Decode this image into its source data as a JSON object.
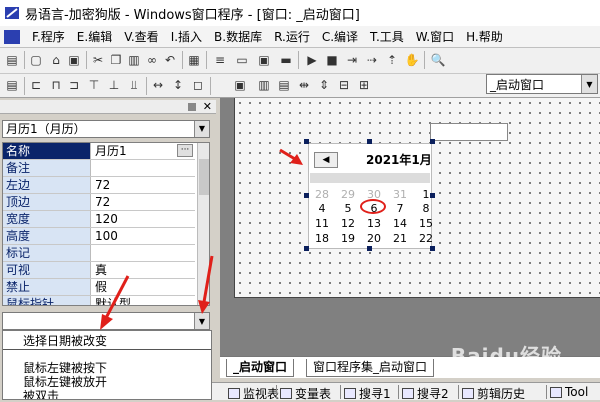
{
  "window": {
    "title": "易语言-加密狗版 - Windows窗口程序 - [窗口: _启动窗口]"
  },
  "menu": [
    "F.程序",
    "E.编辑",
    "V.查看",
    "I.插入",
    "B.数据库",
    "R.运行",
    "C.编译",
    "T.工具",
    "W.窗口",
    "H.帮助"
  ],
  "window_selector": {
    "value": "_启动窗口"
  },
  "object_selector": {
    "value": "月历1（月历）"
  },
  "properties": [
    {
      "name": "名称",
      "value": "月历1"
    },
    {
      "name": "备注",
      "value": ""
    },
    {
      "name": "左边",
      "value": "72"
    },
    {
      "name": "顶边",
      "value": "72"
    },
    {
      "name": "宽度",
      "value": "120"
    },
    {
      "name": "高度",
      "value": "100"
    },
    {
      "name": "标记",
      "value": ""
    },
    {
      "name": "可视",
      "value": "真"
    },
    {
      "name": "禁止",
      "value": "假"
    },
    {
      "name": "鼠标指针",
      "value": "默认型"
    }
  ],
  "events": {
    "selected": "选择日期被改变",
    "items": [
      "鼠标左键被按下",
      "鼠标左键被放开",
      "被双击"
    ]
  },
  "calendar": {
    "prev_button": "◀",
    "title": "2021年1月",
    "rows": [
      [
        "28",
        "29",
        "30",
        "31",
        "1"
      ],
      [
        "4",
        "5",
        "6",
        "7",
        "8"
      ],
      [
        "11",
        "12",
        "13",
        "14",
        "15"
      ],
      [
        "18",
        "19",
        "20",
        "21",
        "22"
      ]
    ],
    "circled_day": "6"
  },
  "tabs": [
    "_启动窗口",
    "窗口程序集_启动窗口"
  ],
  "bottom_tools": [
    "监视表",
    "变量表",
    "搜寻1",
    "搜寻2",
    "剪辑历史",
    "Tool"
  ],
  "watermark": "Baidu经验",
  "colors": {
    "selection": "#0a246a",
    "annotation": "#e0201a",
    "prop_name_bg": "#d8e4f4"
  }
}
